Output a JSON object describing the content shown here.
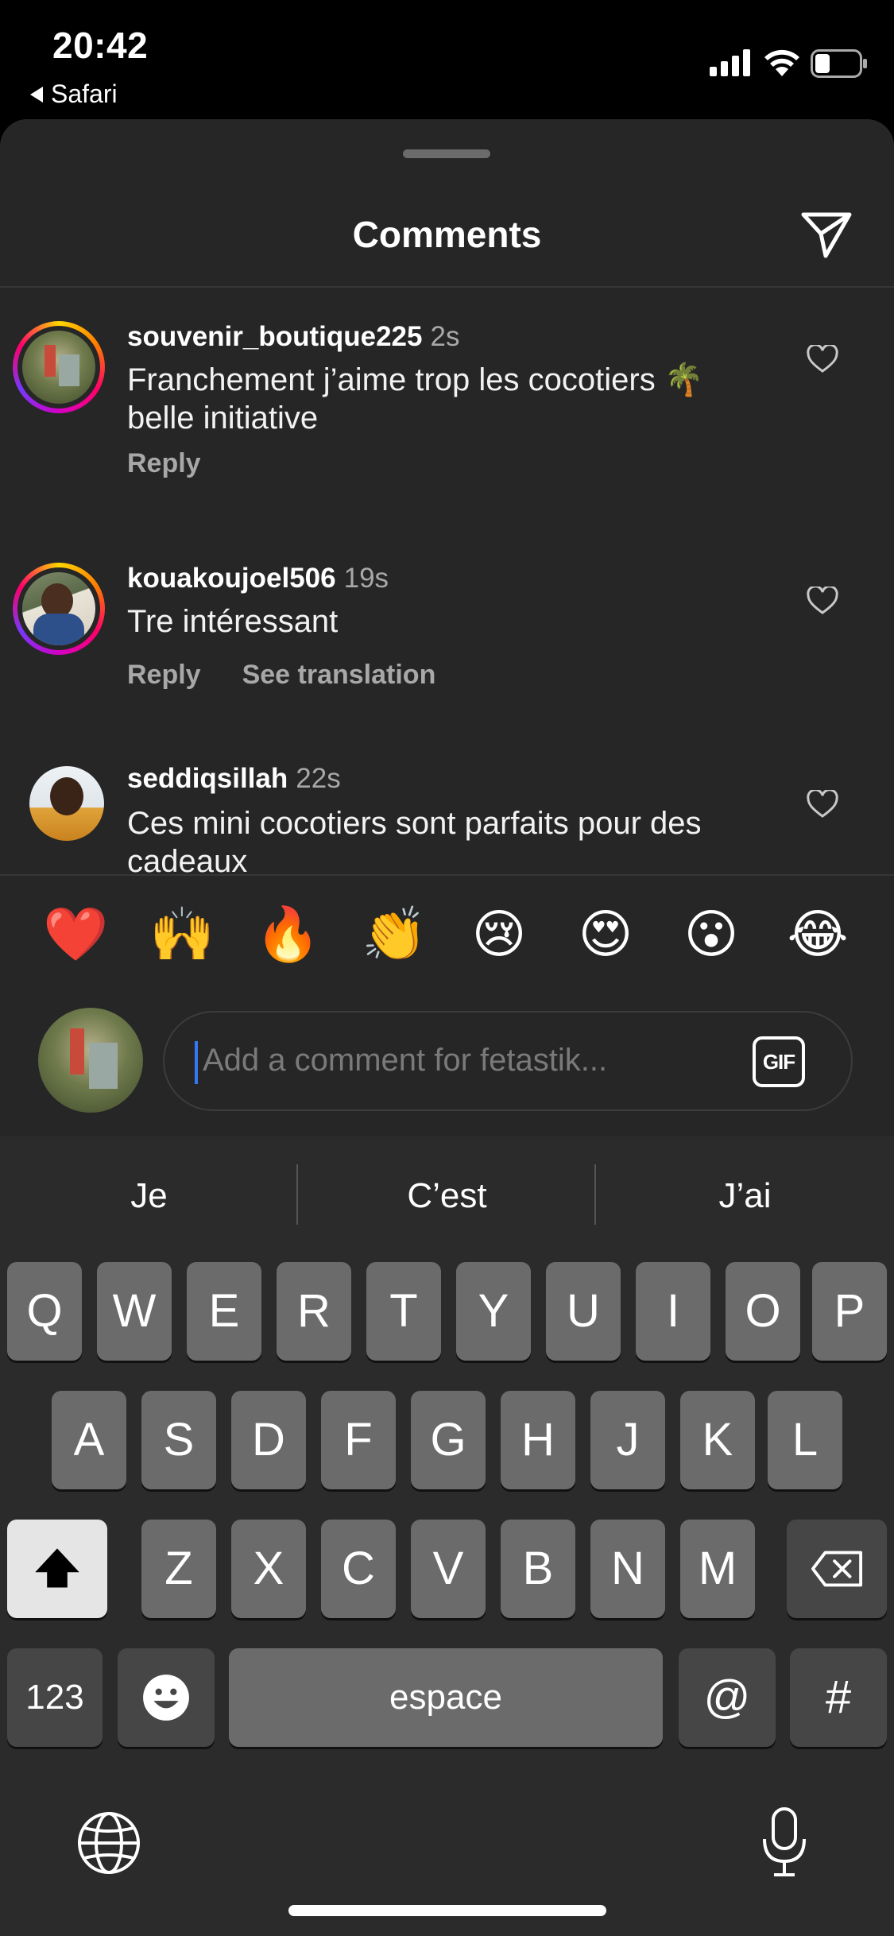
{
  "status_bar": {
    "time": "20:42",
    "back_app": "Safari"
  },
  "sheet": {
    "title": "Comments"
  },
  "comments": [
    {
      "username": "souvenir_boutique225",
      "time": "2s",
      "text": "Franchement j’aime trop les cocotiers 🌴 belle initiative",
      "actions": [
        "Reply"
      ]
    },
    {
      "username": "kouakoujoel506",
      "time": "19s",
      "text": "Tre intéressant",
      "actions": [
        "Reply",
        "See translation"
      ]
    },
    {
      "username": "seddiqsillah",
      "time": "22s",
      "text": "Ces mini cocotiers sont parfaits pour des cadeaux",
      "actions": []
    }
  ],
  "emoji_reactions": [
    "❤️",
    "🙌",
    "🔥",
    "👏",
    "😢",
    "😍",
    "😮",
    "😂"
  ],
  "composer": {
    "placeholder": "Add a comment for fetastik...",
    "gif_label": "GIF"
  },
  "keyboard": {
    "suggestions": [
      "Je",
      "C’est",
      "J’ai"
    ],
    "row1": [
      "Q",
      "W",
      "E",
      "R",
      "T",
      "Y",
      "U",
      "I",
      "O",
      "P"
    ],
    "row2": [
      "A",
      "S",
      "D",
      "F",
      "G",
      "H",
      "J",
      "K",
      "L"
    ],
    "row3": [
      "Z",
      "X",
      "C",
      "V",
      "B",
      "N",
      "M"
    ],
    "numbers_label": "123",
    "space_label": "espace",
    "at_label": "@",
    "hash_label": "#"
  },
  "colors": {
    "sheet_bg": "#262626",
    "keyboard_bg": "#2b2b2b",
    "caret": "#3478f6",
    "muted_text": "#a8a8a8"
  }
}
